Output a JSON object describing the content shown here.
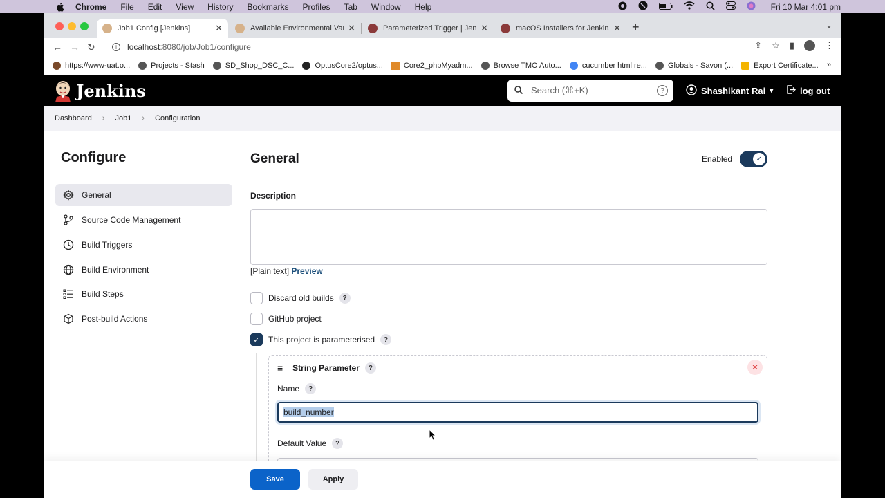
{
  "menubar": {
    "app": "Chrome",
    "items": [
      "File",
      "Edit",
      "View",
      "History",
      "Bookmarks",
      "Profiles",
      "Tab",
      "Window",
      "Help"
    ],
    "clock": "Fri 10 Mar  4:01 pm"
  },
  "tabs": [
    {
      "label": "Job1 Config [Jenkins]",
      "active": true
    },
    {
      "label": "Available Environmental Variabl"
    },
    {
      "label": "Parameterized Trigger | Jenkins"
    },
    {
      "label": "macOS Installers for Jenkins LT"
    }
  ],
  "omnibox": {
    "host": "localhost",
    "path": ":8080/job/Job1/configure"
  },
  "bookmarks": [
    "https://www-uat.o...",
    "Projects - Stash",
    "SD_Shop_DSC_C...",
    "OptusCore2/optus...",
    "Core2_phpMyadm...",
    "Browse TMO Auto...",
    "cucumber html re...",
    "Globals - Savon (...",
    "Export Certificate..."
  ],
  "bookmarks_more": "»",
  "jenkins": {
    "logo_text": "Jenkins",
    "search_placeholder": "Search (⌘+K)",
    "help_icon_label": "?",
    "user": "Shashikant Rai",
    "logout": "log out"
  },
  "breadcrumb": [
    "Dashboard",
    "Job1",
    "Configuration"
  ],
  "sidebar": {
    "title": "Configure",
    "items": [
      {
        "label": "General",
        "icon": "gear-icon"
      },
      {
        "label": "Source Code Management",
        "icon": "branch-icon"
      },
      {
        "label": "Build Triggers",
        "icon": "clock-icon"
      },
      {
        "label": "Build Environment",
        "icon": "globe-icon"
      },
      {
        "label": "Build Steps",
        "icon": "list-icon"
      },
      {
        "label": "Post-build Actions",
        "icon": "package-icon"
      }
    ]
  },
  "general": {
    "title": "General",
    "enabled_label": "Enabled",
    "description_label": "Description",
    "plain_text": "[Plain text]",
    "preview": "Preview",
    "options": [
      {
        "label": "Discard old builds",
        "checked": false,
        "help": true
      },
      {
        "label": "GitHub project",
        "checked": false,
        "help": false
      },
      {
        "label": "This project is parameterised",
        "checked": true,
        "help": true
      }
    ]
  },
  "string_parameter": {
    "title": "String Parameter",
    "name_label": "Name",
    "name_value": "build_number",
    "default_label": "Default Value"
  },
  "buttons": {
    "save": "Save",
    "apply": "Apply"
  }
}
